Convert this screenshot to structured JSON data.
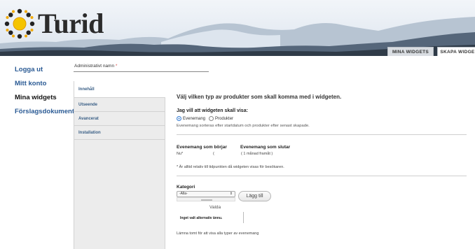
{
  "header": {
    "logo_text": "Turid",
    "tabs": [
      {
        "label": "MINA WIDGETS"
      },
      {
        "label": "SKAPA WIDGE"
      }
    ]
  },
  "leftnav": {
    "items": [
      {
        "label": "Logga ut"
      },
      {
        "label": "Mitt konto"
      },
      {
        "label": "Mina widgets"
      },
      {
        "label": "Förslagsdokument"
      }
    ]
  },
  "admin": {
    "label": "Administrativt namn",
    "required_mark": "*",
    "value": ""
  },
  "inner_nav": {
    "items": [
      {
        "label": "Innehåll"
      },
      {
        "label": "Utseende"
      },
      {
        "label": "Avancerat"
      },
      {
        "label": "Installation"
      }
    ]
  },
  "content": {
    "heading": "Välj vilken typ av produkter som skall komma med i widgeten.",
    "question": "Jag vill att widgeten skall visa:",
    "radio_options": [
      {
        "label": "Evenemang",
        "selected": true
      },
      {
        "label": "Produkter",
        "selected": false
      }
    ],
    "help_text": "Evenemang sorteras efter startdatum och produkter efter senast skapade.",
    "start_label": "Evenemang som börjar",
    "start_value": "Nu*",
    "start_value2": "(",
    "end_label": "Evenemang som slutar",
    "end_value": "( 1 månad framåt )",
    "note": "* Är alltid relativ till tidpunkten då widgeten visas för besökaren.",
    "category_label": "Kategori",
    "category_select": "-Alla-",
    "add_button": "Lägg till",
    "selected_label": "Valda",
    "selected_text": "Inget valt alternativ ännu.",
    "bottom_help": "Lämna tomt för att visa alla typer av evenemang"
  },
  "colors": {
    "link": "#2a5a94",
    "accent_radio": "#3d82d6",
    "required": "#d9534f"
  }
}
